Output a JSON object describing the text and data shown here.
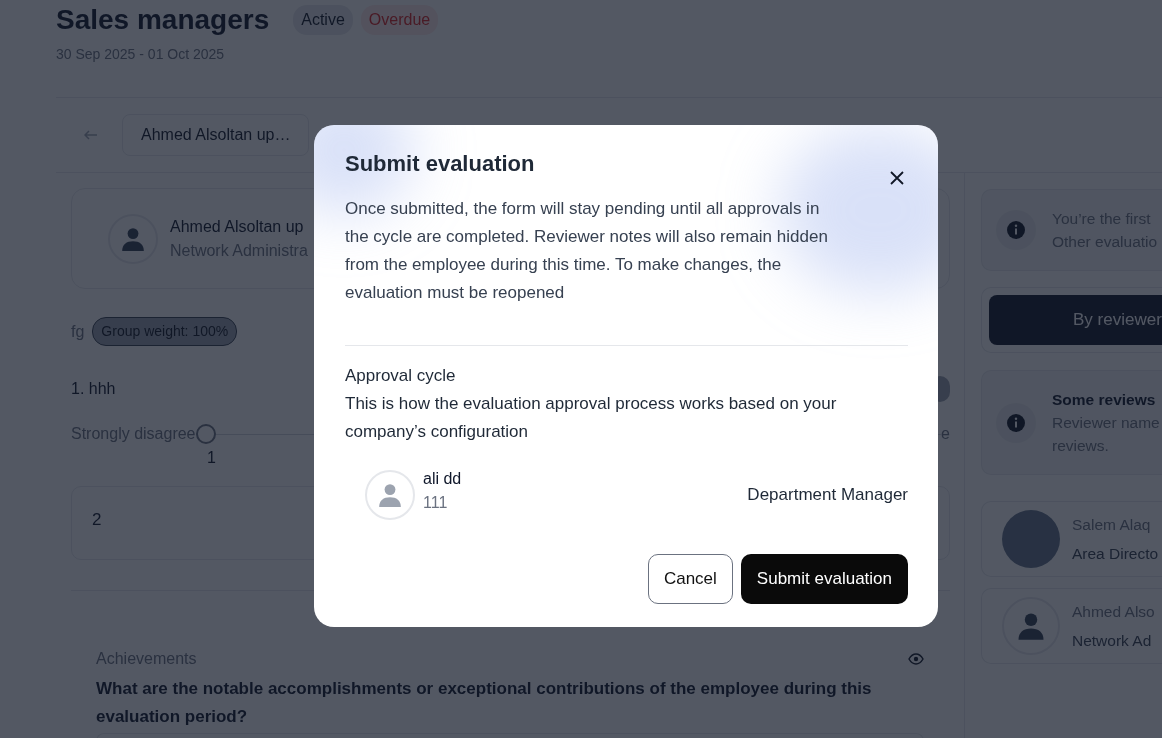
{
  "header": {
    "title": "Sales managers",
    "badges": [
      {
        "label": "Active",
        "kind": "neutral"
      },
      {
        "label": "Overdue",
        "kind": "danger"
      }
    ],
    "date_range": "30 Sep 2025 - 01 Oct 2025"
  },
  "toolbar": {
    "employee_selector": "Ahmed Alsoltan up…"
  },
  "employee_card": {
    "name": "Ahmed Alsoltan up",
    "role": "Network Administra"
  },
  "group": {
    "name": "fg",
    "weight_badge": "Group weight: 100%"
  },
  "question": {
    "title": "1. hhh",
    "scale_min_label": "Strongly disagree",
    "scale_max_label": "e",
    "scale_points": [
      {
        "label": "1",
        "selected": false
      }
    ],
    "answer": "2"
  },
  "achievements": {
    "label": "Achievements",
    "question": "What are the notable accomplishments or exceptional contributions of the employee during this evaluation period?"
  },
  "side_panel": {
    "info_notice": {
      "lines": [
        "You’re the first",
        "Other evaluatio"
      ]
    },
    "view_button": "By reviewer",
    "reviews_notice": {
      "title": "Some reviews",
      "lines": [
        "Reviewer name",
        "reviews."
      ]
    },
    "reviewers": [
      {
        "name": "Salem Alaq",
        "role": "Area Directo",
        "photo": true
      },
      {
        "name": "Ahmed Also",
        "role": "Network Ad",
        "photo": false
      }
    ]
  },
  "modal": {
    "title": "Submit evaluation",
    "description": "Once submitted, the form will stay pending until all approvals in the cycle are completed. Reviewer notes will also remain hidden from the employee during this time. To make changes, the evaluation must be reopened",
    "section_title": "Approval cycle",
    "section_description": "This is how the evaluation approval process works based on your company’s configuration",
    "approvers": [
      {
        "name": "ali dd",
        "code": "111",
        "role": "Department Manager"
      }
    ],
    "buttons": [
      {
        "label": "Cancel",
        "kind": "secondary"
      },
      {
        "label": "Submit evaluation",
        "kind": "primary"
      }
    ]
  }
}
